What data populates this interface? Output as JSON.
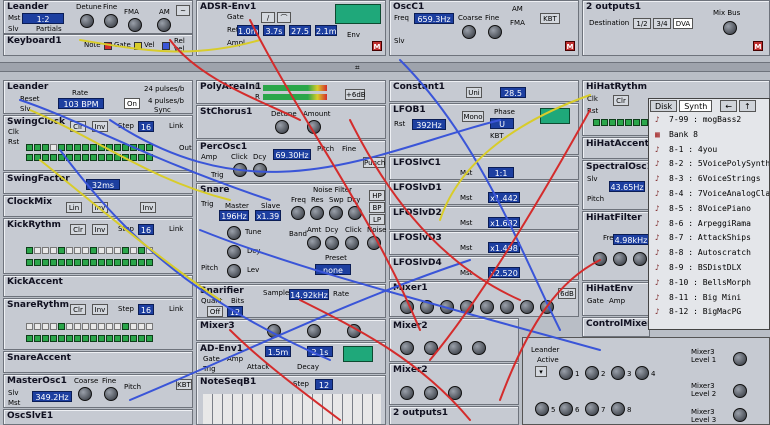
{
  "modules": {
    "leander_top": {
      "title": "Leander",
      "detune": "Detune",
      "fine": "Fine",
      "fma": "FMA",
      "am": "AM",
      "mst": "Mst",
      "partials": "Partials",
      "slv": "Slv",
      "value": "1:2"
    },
    "adsr_env1": {
      "title": "ADSR-Env1",
      "gate": "Gate",
      "retrig": "Retrig",
      "ampl": "Ampl",
      "a": "1.0m",
      "d": "3.7s",
      "s": "27.5",
      "r": "2.1m",
      "env": "Env"
    },
    "oscc1": {
      "title": "OscC1",
      "freq_label": "Freq",
      "freq": "659.3Hz",
      "coarse": "Coarse",
      "fine": "Fine",
      "am": "AM",
      "fma": "FMA",
      "kbt": "KBT",
      "slv": "Slv"
    },
    "two_outputs1": {
      "title": "2 outputs1",
      "destination": "Destination",
      "opt1": "1/2",
      "opt2": "3/4",
      "opt3": "DVA",
      "mixbus": "Mix Bus"
    },
    "keyboard1": {
      "title": "Keyboard1",
      "note": "Note",
      "gate": "Gate",
      "vel": "Vel",
      "relvel": "Rel vel"
    },
    "leander2": {
      "title": "Leander",
      "reset": "Reset",
      "slv": "Slv",
      "rate": "Rate",
      "bpm": "103 BPM",
      "pulses1": "24 pulses/b",
      "pulses2": "4 pulses/b",
      "on": "On",
      "sync": "Sync"
    },
    "swingclock": {
      "title": "SwingClock",
      "clk": "Clk",
      "rst": "Rst",
      "clr": "Clr",
      "inv": "Inv",
      "step": "Step",
      "step_val": "16",
      "link": "Link",
      "pat": "Pat",
      "out": "Out"
    },
    "swingfactor": {
      "title": "SwingFactor",
      "value": "32ms"
    },
    "clockmix": {
      "title": "ClockMix",
      "lin": "Lin",
      "inv": "Inv",
      "inv2": "Inv"
    },
    "kickrythm": {
      "title": "KickRythm",
      "step": "Step",
      "step_val": "16",
      "link": "Link",
      "clr": "Clr",
      "inv": "Inv"
    },
    "kickaccent": {
      "title": "KickAccent"
    },
    "snarerythm": {
      "title": "SnareRythm",
      "step": "Step",
      "step_val": "16",
      "link": "Link",
      "clr": "Clr",
      "inv": "Inv"
    },
    "snareaccent": {
      "title": "SnareAccent"
    },
    "masterosc1": {
      "title": "MasterOsc1",
      "freq": "349.2Hz",
      "coarse": "Coarse",
      "fine": "Fine",
      "pitch": "Pitch",
      "kbt": "KBT",
      "slv": "Slv",
      "mst": "Mst"
    },
    "oscslvc1": {
      "title": "OscSlvE1"
    },
    "polyarea1": {
      "title": "PolyAreaIn1",
      "l": "L",
      "r": "R",
      "db": "+6dB"
    },
    "stchorus1": {
      "title": "StChorus1",
      "detune": "Detune",
      "amount": "Amount"
    },
    "percosc1": {
      "title": "PercOsc1",
      "amp": "Amp",
      "click": "Click",
      "dcy": "Dcy",
      "freq": "69.30Hz",
      "pitch": "Pitch",
      "fine": "Fine",
      "trig": "Trig",
      "punch": "Punch"
    },
    "snare": {
      "title": "Snare",
      "trig": "Trig",
      "master": "Master",
      "slave": "Slave",
      "noise_filter": "Noise Filter",
      "freq": "196Hz",
      "mul": "x1.39",
      "tune": "Tune",
      "dcy": "Dcy",
      "lev": "Lev",
      "nfreq": "Freq",
      "res": "Res",
      "swp": "Swp",
      "ndcy": "Dcy",
      "amt": "Amt",
      "band": "Band",
      "hp": "HP",
      "bp": "BP",
      "lp": "LP",
      "click": "Click",
      "noise": "Noise",
      "preset": "Preset",
      "preset_val": "none",
      "pitch": "Pitch"
    },
    "snarifier": {
      "title": "Snarifier",
      "sample": "Sample",
      "sample_val": "14.92kHz",
      "rate": "Rate",
      "quant": "Quant",
      "bits": "Bits",
      "off": "Off",
      "bits_val": "12"
    },
    "mixer3": {
      "title": "Mixer3"
    },
    "ad_env1": {
      "title": "AD-Env1",
      "gate": "Gate",
      "amp": "Amp",
      "attack": "Attack",
      "decay": "Decay",
      "a": "1.5m",
      "d": "2.1s",
      "trig": "Trig"
    },
    "noteseq": {
      "title": "NoteSeqB1",
      "step": "Step",
      "step_val": "12"
    },
    "constant1": {
      "title": "Constant1",
      "uni": "Uni",
      "value": "28.5"
    },
    "lfob1": {
      "title": "LFOB1",
      "rst": "Rst",
      "rate": "392Hz",
      "mono": "Mono",
      "phase": "Phase",
      "phase_val": "U",
      "kbt": "KBT"
    },
    "lfoslv": [
      {
        "title": "LFOSlvC1",
        "mst": "Mst",
        "ratio": "1:1"
      },
      {
        "title": "LFOSlvD1",
        "mst": "Mst",
        "ratio": "x1.442"
      },
      {
        "title": "LFOSlvD2",
        "mst": "Mst",
        "ratio": "x1.682"
      },
      {
        "title": "LFOSlvD3",
        "mst": "Mst",
        "ratio": "x1.498"
      },
      {
        "title": "LFOSlvD4",
        "mst": "Mst",
        "ratio": "x2.520"
      }
    ],
    "mixer1": {
      "title": "Mixer1",
      "db": "6dB"
    },
    "mixer2": {
      "title": "Mixer2"
    },
    "mixer2b": {
      "title": "Mixer2"
    },
    "two_outputs_b": {
      "title": "2 outputs1"
    },
    "hihatrythm": {
      "title": "HiHatRythm",
      "clk": "Clk",
      "rst": "Rst",
      "clr": "Clr",
      "inv": "Inv",
      "step": "Step",
      "step_val": "16"
    },
    "hihataccent": {
      "title": "HiHatAccent"
    },
    "spectralosc1": {
      "title": "SpectralOsc1",
      "slv": "Slv",
      "freq": "43.65Hz",
      "pitch": "Pitch"
    },
    "hihatfilter": {
      "title": "HiHatFilter",
      "freq": "Freq",
      "freq_val": "4.98kHz"
    },
    "hihatenv": {
      "title": "HiHatEnv",
      "gate": "Gate",
      "amp": "Amp"
    },
    "controlmixer": {
      "title": "ControlMixer2"
    }
  },
  "browser": {
    "tab1": "Disk",
    "tab2": "Synth",
    "back": "←",
    "up": "↑",
    "fwd": "→",
    "items": [
      {
        "label": "7-99 : mogBass2",
        "bank": false
      },
      {
        "label": "Bank 8",
        "bank": true
      },
      {
        "label": "8-1 : 4you",
        "bank": false
      },
      {
        "label": "8-2 : 5VoicePolySynth",
        "bank": false
      },
      {
        "label": "8-3 : 6VoiceStrings",
        "bank": false
      },
      {
        "label": "8-4 : 7VoiceAnalogClav",
        "bank": false
      },
      {
        "label": "8-5 : 8VoicePiano",
        "bank": false
      },
      {
        "label": "8-6 : ArpeggiRama",
        "bank": false
      },
      {
        "label": "8-7 : AttackShips",
        "bank": false
      },
      {
        "label": "8-8 : Autoscratch",
        "bank": false
      },
      {
        "label": "8-9 : BSDistDLX",
        "bank": false
      },
      {
        "label": "8-10 : BellsMorph",
        "bank": false
      },
      {
        "label": "8-11 : Big Mini",
        "bank": false
      },
      {
        "label": "8-12 : BigMacPG",
        "bank": false
      }
    ]
  },
  "panel": {
    "leander": "Leander",
    "active": "Active",
    "mixer3_l1": "Mixer3",
    "mixer3_l1b": "Level 1",
    "mixer3_l2": "Mixer3",
    "mixer3_l2b": "Level 2",
    "mixer3_l3": "Mixer3",
    "mixer3_l3b": "Level 3",
    "knob_nums": [
      "1",
      "2",
      "3",
      "4",
      "5",
      "6",
      "7",
      "8"
    ]
  },
  "separator": {
    "center": "⌗"
  }
}
